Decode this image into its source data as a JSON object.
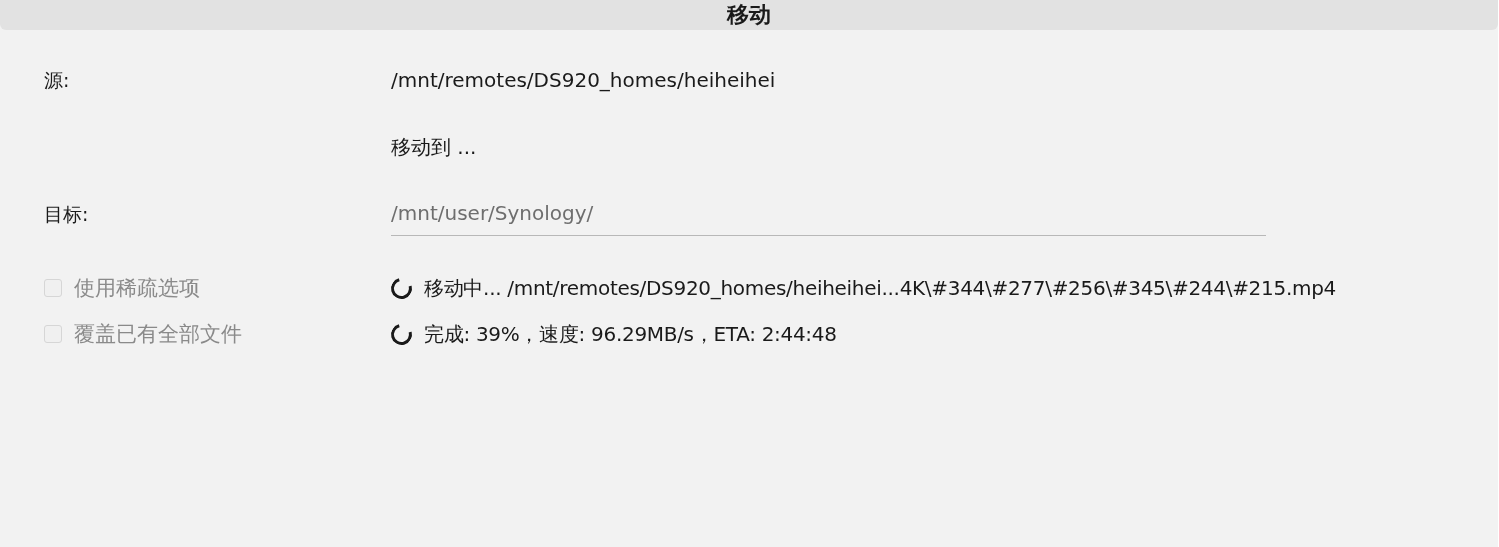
{
  "window": {
    "title": "移动"
  },
  "source": {
    "label": "源:",
    "value": "/mnt/remotes/DS920_homes/heiheihei"
  },
  "action": {
    "text": "移动到 ..."
  },
  "target": {
    "label": "目标:",
    "value": "/mnt/user/Synology/",
    "disabled": true
  },
  "options": [
    {
      "label": "使用稀疏选项",
      "checked": false,
      "disabled": true
    },
    {
      "label": "覆盖已有全部文件",
      "checked": false,
      "disabled": true
    }
  ],
  "status": [
    {
      "text": "移动中... /mnt/remotes/DS920_homes/heiheihei...4K\\#344\\#277\\#256\\#345\\#244\\#215.mp4"
    },
    {
      "text": "完成: 39%，速度: 96.29MB/s，ETA: 2:44:48"
    }
  ]
}
